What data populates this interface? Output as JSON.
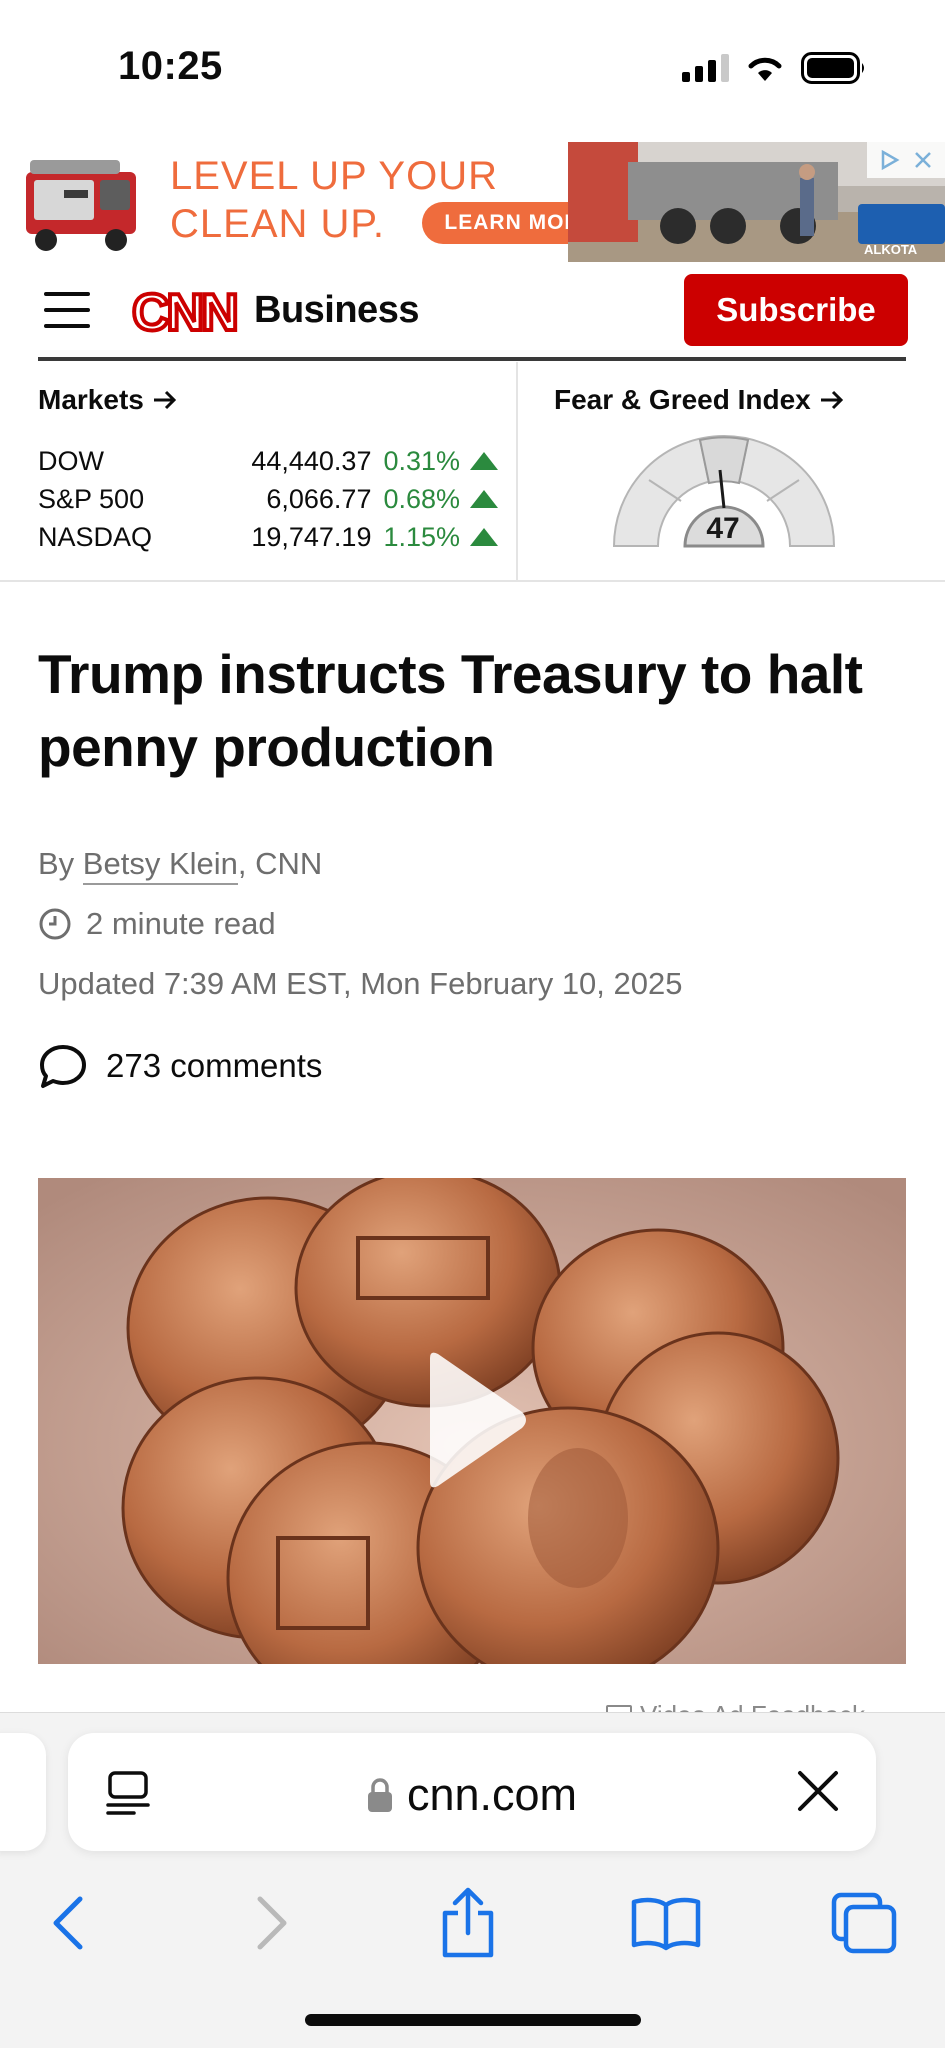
{
  "status_bar": {
    "time": "10:25",
    "icons": [
      "cellular-signal-icon",
      "wifi-icon",
      "battery-icon"
    ]
  },
  "ad": {
    "headline_line1": "LEVEL UP YOUR",
    "headline_line2": "CLEAN UP.",
    "cta": "LEARN MORE",
    "truck_brand": "ALKOTA",
    "accent_color": "#ef6c3d"
  },
  "header": {
    "logo": "CNN",
    "section": "Business",
    "subscribe_label": "Subscribe",
    "brand_color": "#cc0000"
  },
  "markets": {
    "title": "Markets",
    "rows": [
      {
        "name": "DOW",
        "value": "44,440.37",
        "change": "0.31%"
      },
      {
        "name": "S&P 500",
        "value": "6,066.77",
        "change": "0.68%"
      },
      {
        "name": "NASDAQ",
        "value": "19,747.19",
        "change": "1.15%"
      }
    ],
    "up_color": "#2b8a3e"
  },
  "fear_greed": {
    "title": "Fear & Greed Index",
    "value": "47"
  },
  "article": {
    "headline": "Trump instructs Treasury to halt penny production",
    "byline_prefix": "By ",
    "author": "Betsy Klein",
    "byline_suffix": ", CNN",
    "read_time": "2 minute read",
    "updated": "Updated 7:39 AM EST, Mon February 10, 2025",
    "comments": "273 comments"
  },
  "video": {
    "ad_feedback": "Video Ad Feedback"
  },
  "safari": {
    "address": "cnn.com",
    "toolbar": [
      "back-icon",
      "forward-icon",
      "share-icon",
      "bookmarks-icon",
      "tabs-icon"
    ]
  }
}
